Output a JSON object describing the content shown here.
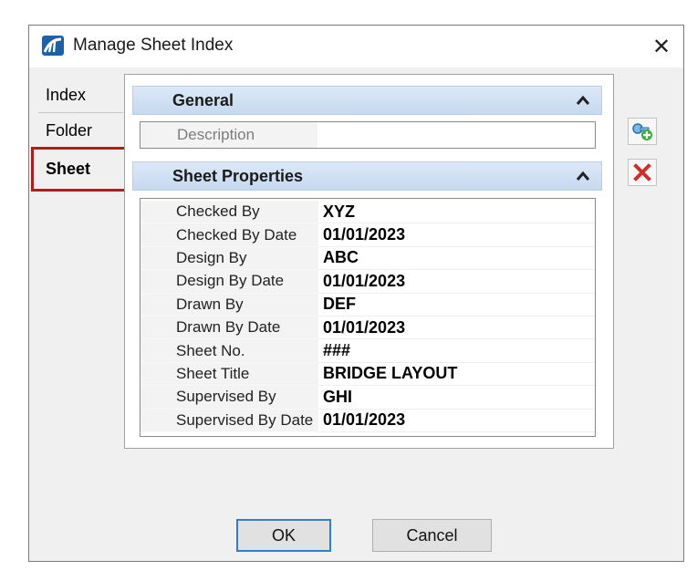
{
  "window": {
    "title": "Manage Sheet Index",
    "app_icon": "bentley-arch-icon",
    "close_glyph": "✕"
  },
  "tabs": [
    {
      "label": "Index",
      "selected": false
    },
    {
      "label": "Folder",
      "selected": false
    },
    {
      "label": "Sheet",
      "selected": true,
      "highlight_color": "#b01d1d"
    }
  ],
  "general": {
    "header": "General",
    "description_label": "Description",
    "description_value": ""
  },
  "sheet_properties": {
    "header": "Sheet Properties",
    "rows": [
      {
        "name": "Checked By",
        "value": "XYZ"
      },
      {
        "name": "Checked By Date",
        "value": "01/01/2023"
      },
      {
        "name": "Design By",
        "value": "ABC"
      },
      {
        "name": "Design By Date",
        "value": "01/01/2023"
      },
      {
        "name": "Drawn By",
        "value": "DEF"
      },
      {
        "name": "Drawn By Date",
        "value": "01/01/2023"
      },
      {
        "name": "Sheet No.",
        "value": "###"
      },
      {
        "name": "Sheet Title",
        "value": "BRIDGE LAYOUT"
      },
      {
        "name": "Supervised By",
        "value": "GHI"
      },
      {
        "name": "Supervised By Date",
        "value": "01/01/2023"
      }
    ]
  },
  "side_actions": {
    "add_icon": "add-property-icon",
    "delete_icon": "delete-icon"
  },
  "buttons": {
    "ok": "OK",
    "cancel": "Cancel"
  },
  "colors": {
    "header_gradient_top": "#dce8f7",
    "header_gradient_bottom": "#c6d9f0",
    "delete_red": "#d42b2b",
    "ok_border": "#2f7fd1"
  }
}
